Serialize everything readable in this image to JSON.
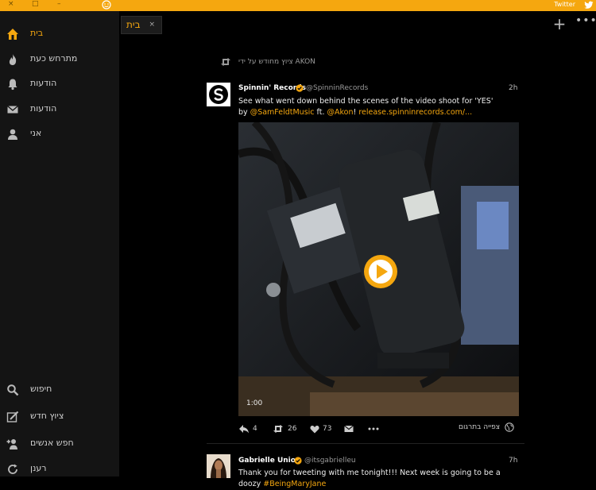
{
  "window": {
    "title": "Twitter",
    "controls": [
      "×",
      "□",
      "–"
    ]
  },
  "sidebar": {
    "top": [
      {
        "label": "בית",
        "icon": "home-icon",
        "active": true
      },
      {
        "label": "מתרחש כעת",
        "icon": "flame-icon"
      },
      {
        "label": "הודעות",
        "icon": "bell-icon"
      },
      {
        "label": "הודעות",
        "icon": "envelope-icon"
      },
      {
        "label": "אני",
        "icon": "person-icon"
      }
    ],
    "bottom": [
      {
        "label": "חיפוש",
        "icon": "search-icon"
      },
      {
        "label": "ציוץ חדש",
        "icon": "compose-icon"
      },
      {
        "label": "חפש אנשים",
        "icon": "add-person-icon"
      },
      {
        "label": "רענן",
        "icon": "refresh-icon"
      }
    ]
  },
  "tabs": [
    {
      "label": "בית",
      "close": "×"
    }
  ],
  "toolbar": {
    "plus": "+",
    "more": "•••"
  },
  "tweets": [
    {
      "retweet_note": "ציוץ מחודש על ידי AKON",
      "name": "Spinnin' Records",
      "handle": "@SpinninRecords",
      "time": "2h",
      "text_line1": "See what went down behind the scenes of the video shoot for 'YES'",
      "text_by": "by ",
      "mention1": "@SamFeldtMusic",
      "text_ft": " ft. ",
      "mention2": "@Akon",
      "text_bang": "! ",
      "url": "release.spinninrecords.com/...",
      "duration": "1:00",
      "replies": "4",
      "retweets": "26",
      "likes": "73",
      "translate": "צפייה בתרגום"
    },
    {
      "name": "Gabrielle Union",
      "handle": "@itsgabrielleu",
      "time": "7h",
      "text": "Thank you for tweeting with me tonight!!! Next week is going to be a doozy ",
      "hashtag": "#BeingMaryJane"
    }
  ],
  "colors": {
    "accent": "#f5a70f",
    "background": "#000000",
    "sidebar": "#141414"
  }
}
